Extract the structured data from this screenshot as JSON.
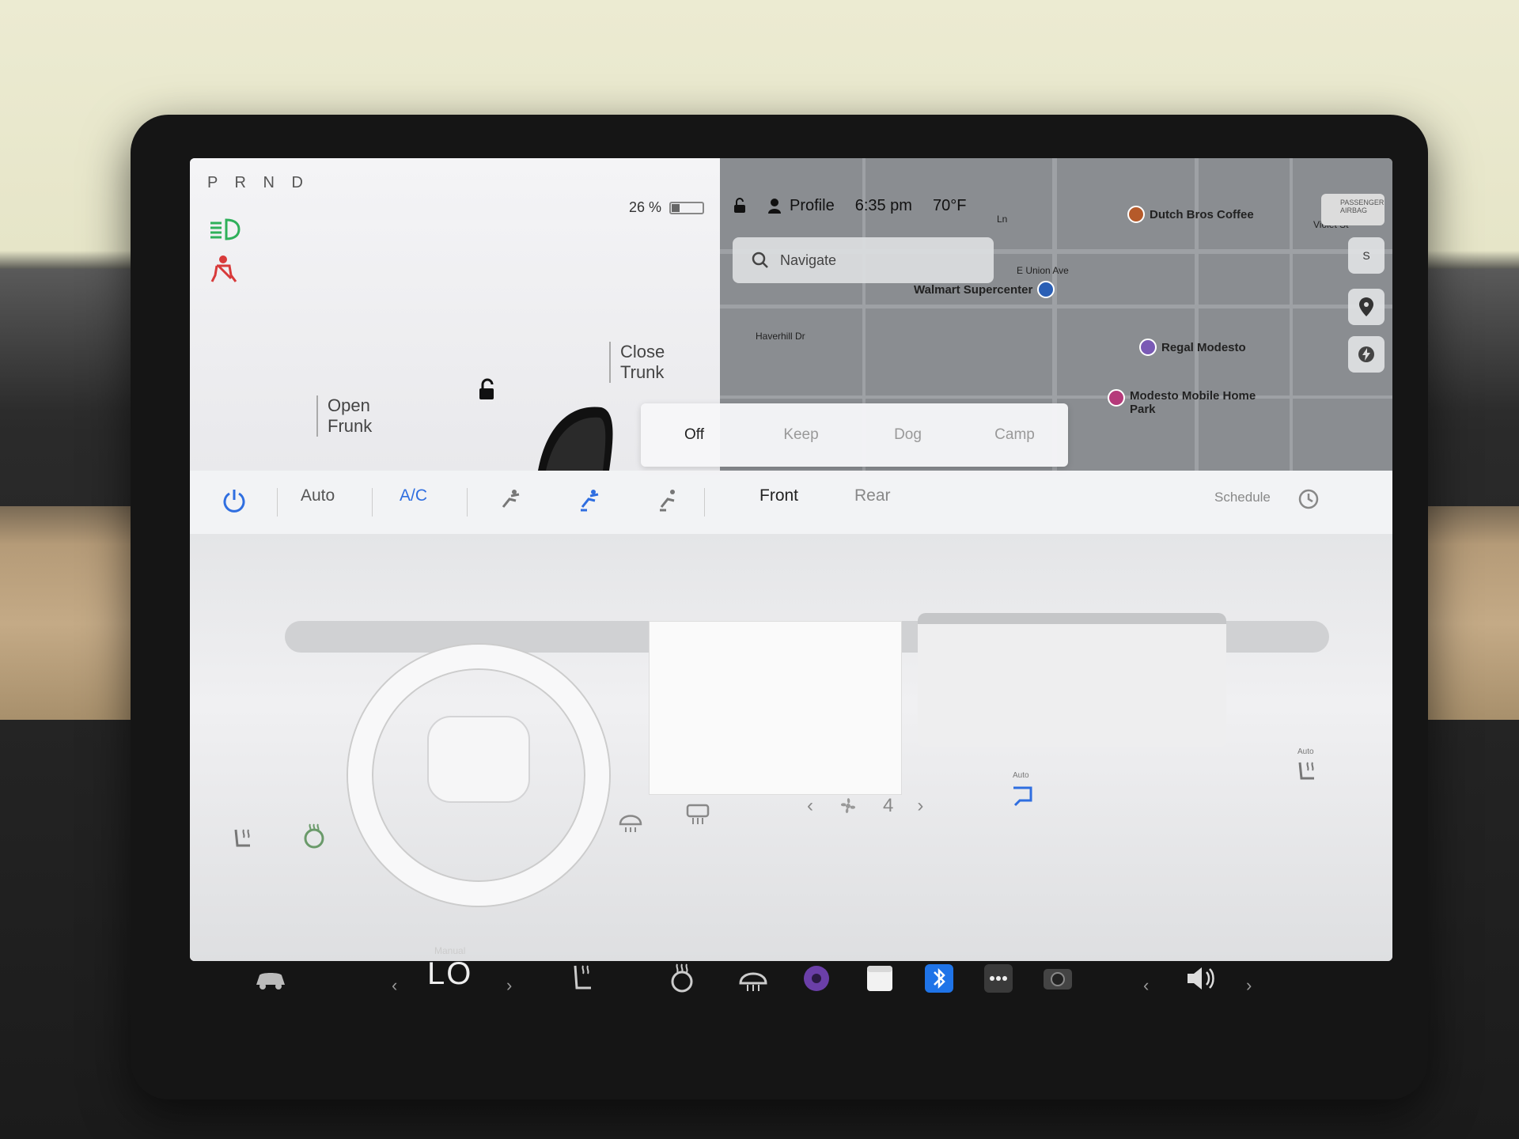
{
  "status": {
    "gear": "P R N D",
    "battery_text": "26 %",
    "battery_level": 0.26,
    "profile_label": "Profile",
    "time": "6:35 pm",
    "temperature": "70°F",
    "airbag_text": "PASSENGER AIRBAG"
  },
  "car": {
    "frunk_line1": "Open",
    "frunk_line2": "Frunk",
    "trunk_line1": "Close",
    "trunk_line2": "Trunk"
  },
  "map": {
    "search_placeholder": "Navigate",
    "streets": [
      "Ln",
      "E Union Ave",
      "Haverhill Dr",
      "Violet St"
    ],
    "pois": [
      {
        "name": "Dutch Bros Coffee",
        "color": "#b55a2a"
      },
      {
        "name": "Walmart Supercenter",
        "color": "#2a5fb5"
      },
      {
        "name": "Regal Modesto",
        "color": "#7a5ab5"
      },
      {
        "name": "Modesto Mobile Home",
        "name2": "Park",
        "color": "#b53a7a"
      }
    ],
    "compass": "S"
  },
  "climate_modes": {
    "items": [
      "Off",
      "Keep",
      "Dog",
      "Camp"
    ],
    "active": "Off"
  },
  "climate": {
    "auto_label": "Auto",
    "ac_label": "A/C",
    "front_label": "Front",
    "rear_label": "Rear",
    "schedule_label": "Schedule",
    "fan_speed": "4",
    "defrost_auto_label": "Auto",
    "seat_auto_label": "Auto"
  },
  "dock": {
    "temp_mode": "Manual",
    "temp_value": "LO"
  },
  "colors": {
    "accent_blue": "#2f6ee0",
    "light_green": "#2fb05a",
    "seatbelt_red": "#d83a3a"
  }
}
